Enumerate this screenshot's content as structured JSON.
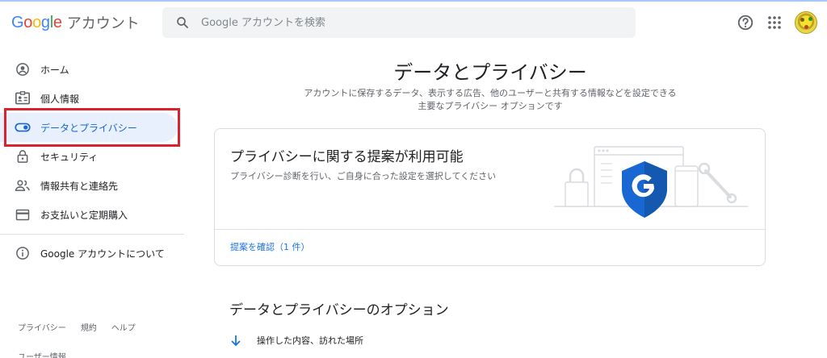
{
  "header": {
    "logo_google": "Google",
    "logo_product": "アカウント",
    "search_placeholder": "Google アカウントを検索",
    "colors": {
      "blue": "#4285f4",
      "red": "#ea4335",
      "yellow": "#fbbc05",
      "green": "#34a853"
    }
  },
  "sidebar": {
    "items": [
      {
        "label": "ホーム",
        "icon": "home-account-icon"
      },
      {
        "label": "個人情報",
        "icon": "badge-icon"
      },
      {
        "label": "データとプライバシー",
        "icon": "toggle-icon",
        "active": true
      },
      {
        "label": "セキュリティ",
        "icon": "lock-icon"
      },
      {
        "label": "情報共有と連絡先",
        "icon": "people-icon"
      },
      {
        "label": "お支払いと定期購入",
        "icon": "credit-card-icon"
      }
    ],
    "about": {
      "label": "Google アカウントについて",
      "icon": "info-icon"
    },
    "footer": {
      "privacy": "プライバシー",
      "terms": "規約",
      "help": "ヘルプ",
      "user_info": "ユーザー情報"
    },
    "highlight_color": "#d9232e"
  },
  "main": {
    "title": "データとプライバシー",
    "description_line1": "アカウントに保存するデータ、表示する広告、他のユーザーと共有する情報などを設定できる",
    "description_line2": "主要なプライバシー オプションです",
    "card": {
      "title": "プライバシーに関する提案が利用可能",
      "description": "プライバシー診断を行い、ご自身に合った設定を選択してください",
      "link": "提案を確認（1 件）"
    },
    "section_title": "データとプライバシーのオプション",
    "option": {
      "label": "操作した内容、訪れた場所",
      "icon": "arrow-down-icon"
    }
  }
}
